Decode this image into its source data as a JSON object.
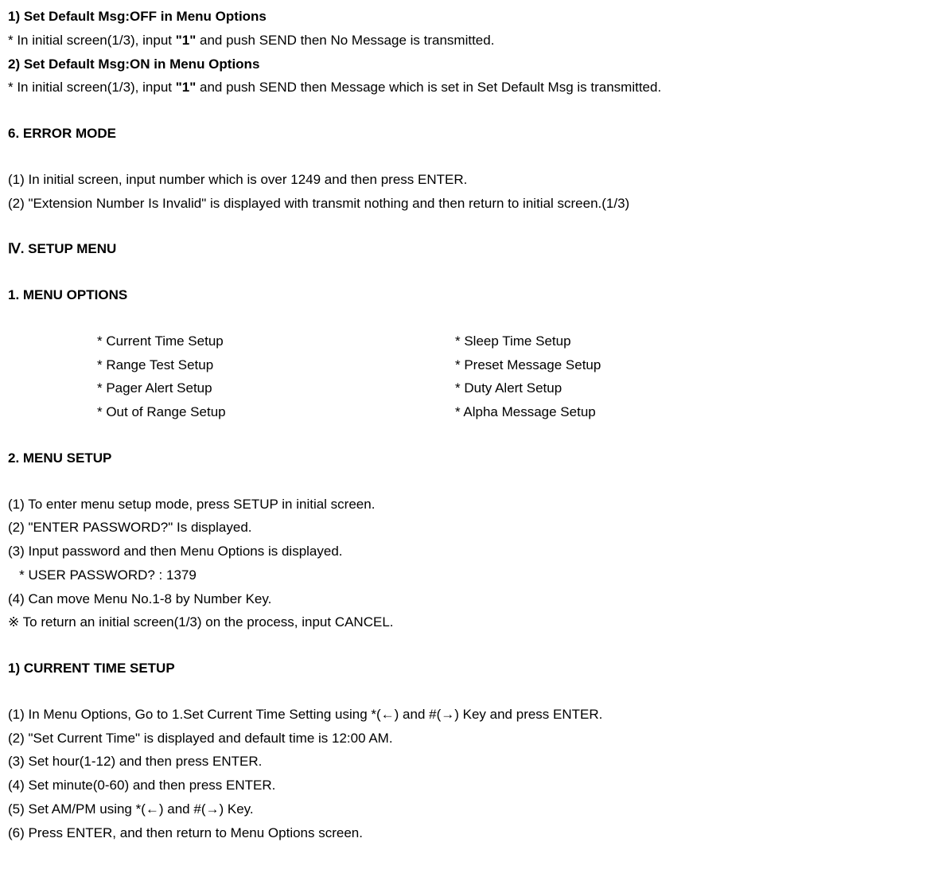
{
  "line1_bold": "1) Set Default Msg:OFF in Menu Options",
  "line1_sub_a": " * In initial screen(1/3), input ",
  "line1_sub_b": "\"1\"",
  "line1_sub_c": " and push SEND then No Message is transmitted.",
  "line2_bold": "2) Set Default Msg:ON in Menu Options",
  "line2_sub_a": " * In initial screen(1/3), input ",
  "line2_sub_b": "\"1\"",
  "line2_sub_c": " and push SEND then Message which is set in Set Default Msg is transmitted.",
  "h6": "6. ERROR MODE",
  "h6_1": "(1) In initial screen, input number which is over 1249 and then press ENTER.",
  "h6_2": "(2) \"Extension Number Is Invalid\" is displayed with transmit nothing and then return to initial screen.(1/3)",
  "roman4": "Ⅳ. SETUP MENU",
  "m1": "1. MENU OPTIONS",
  "menu_left": [
    "* Current Time Setup",
    "* Range Test Setup",
    "* Pager Alert Setup",
    "* Out of Range Setup"
  ],
  "menu_right": [
    "* Sleep Time Setup",
    "* Preset Message Setup",
    "* Duty Alert Setup",
    "* Alpha Message Setup"
  ],
  "m2": "2. MENU SETUP",
  "m2_1": "(1) To enter menu setup mode, press SETUP in initial screen.",
  "m2_2": "(2) \"ENTER PASSWORD?\" Is displayed.",
  "m2_3": "(3) Input password and then Menu Options is displayed.",
  "m2_pw": "   * USER PASSWORD? : 1379",
  "m2_4": "(4) Can move Menu No.1-8 by Number Key.",
  "m2_note": "※ To return an initial screen(1/3) on the process, input CANCEL.",
  "cts": "1) CURRENT TIME SETUP",
  "cts_1": "(1)  In Menu Options, Go to 1.Set Current Time Setting using *(←) and #(→) Key and press ENTER.",
  "cts_2": "(2) \"Set Current Time\" is displayed and default time is 12:00 AM.",
  "cts_3": "(3) Set hour(1-12) and then press ENTER.",
  "cts_4": "(4) Set minute(0-60) and then press ENTER.",
  "cts_5": "(5) Set AM/PM using *(←) and #(→) Key.",
  "cts_6": "(6) Press ENTER, and then return to Menu Options screen."
}
